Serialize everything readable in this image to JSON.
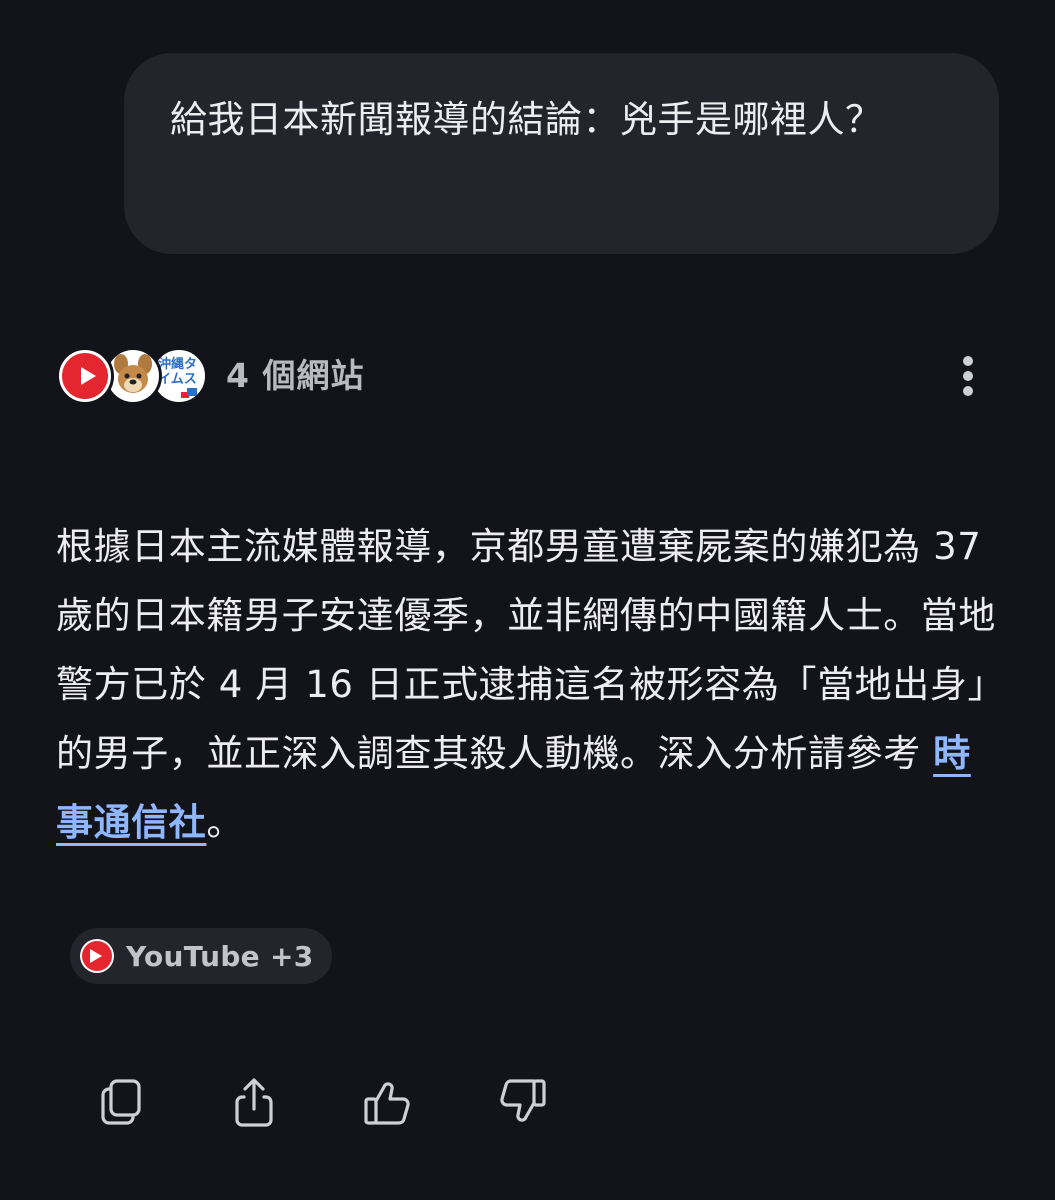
{
  "user_message": {
    "text": "給我日本新聞報導的結論：兇手是哪裡人？"
  },
  "sources": {
    "label": "4 個網站",
    "favicons": [
      "youtube-icon",
      "dog-mascot-icon",
      "okinawa-times-icon"
    ],
    "okinawa_logo_text": "沖縄タイムス"
  },
  "answer": {
    "text_before_link": "根據日本主流媒體報導，京都男童遭棄屍案的嫌犯為 37 歲的日本籍男子安達優季，並非網傳的中國籍人士。當地警方已於 4 月 16 日正式逮捕這名被形容為「當地出身」的男子，並正深入調查其殺人動機。深入分析請參考 ",
    "link_text": "時事通信社",
    "text_after_link": "。"
  },
  "source_chip": {
    "label": "YouTube +3",
    "icon": "youtube-icon"
  },
  "actions": {
    "copy": "copy-icon",
    "share": "share-icon",
    "like": "thumbs-up-icon",
    "dislike": "thumbs-down-icon"
  },
  "colors": {
    "background": "#13131a",
    "bubble": "#24242d",
    "link": "#8fb7ff",
    "youtube_red": "#e3262f"
  }
}
